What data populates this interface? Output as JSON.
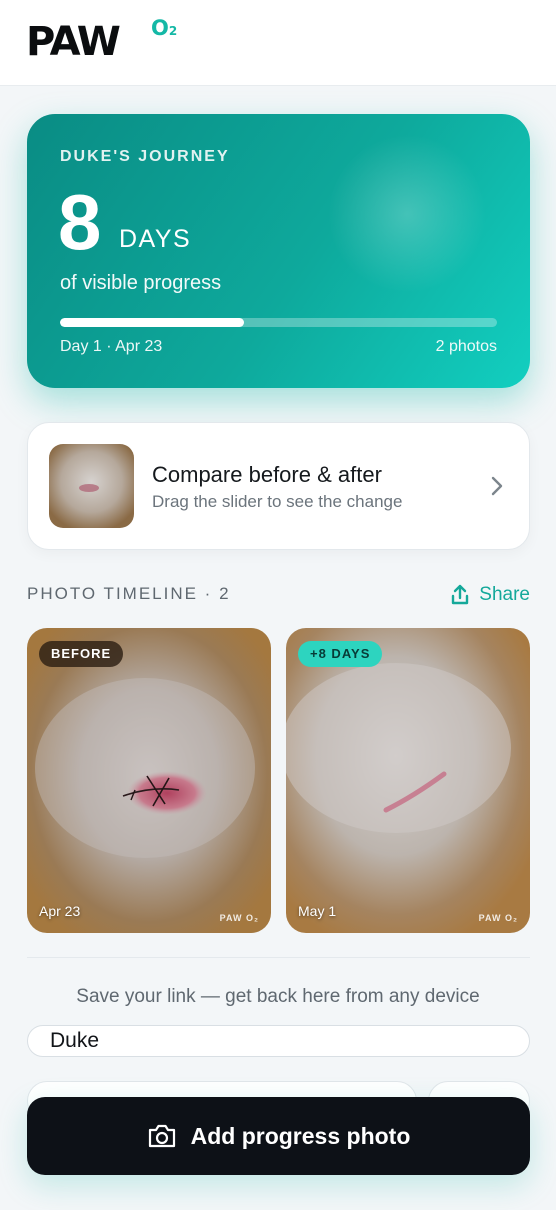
{
  "brand": {
    "name": "PAW",
    "suffix": "O",
    "suffix_sub": "2"
  },
  "hero": {
    "eyebrow": "DUKE'S JOURNEY",
    "days": "8",
    "unit": "DAYS",
    "subtitle": "of visible progress",
    "progress": 0.42,
    "start_label": "Day 1 · Apr 23",
    "photo_count": "2 photos"
  },
  "compare": {
    "title": "Compare before & after",
    "subtitle": "Drag the slider to see the change"
  },
  "timeline": {
    "title": "PHOTO TIMELINE · 2",
    "share_label": "Share",
    "photos": [
      {
        "badge": "BEFORE",
        "date": "Apr 23",
        "watermark": "PAW O₂"
      },
      {
        "badge": "+8 DAYS",
        "date": "May 1",
        "watermark": "PAW O₂"
      }
    ]
  },
  "save": {
    "text": "Save your link — get back here from any device",
    "name_value": "Duke"
  },
  "cta": {
    "label": "Add progress photo"
  },
  "colors": {
    "accent": "#14b8a6",
    "hero_start": "#0a8c84",
    "hero_end": "#12cfc0",
    "cta_bg": "#0d1117"
  }
}
